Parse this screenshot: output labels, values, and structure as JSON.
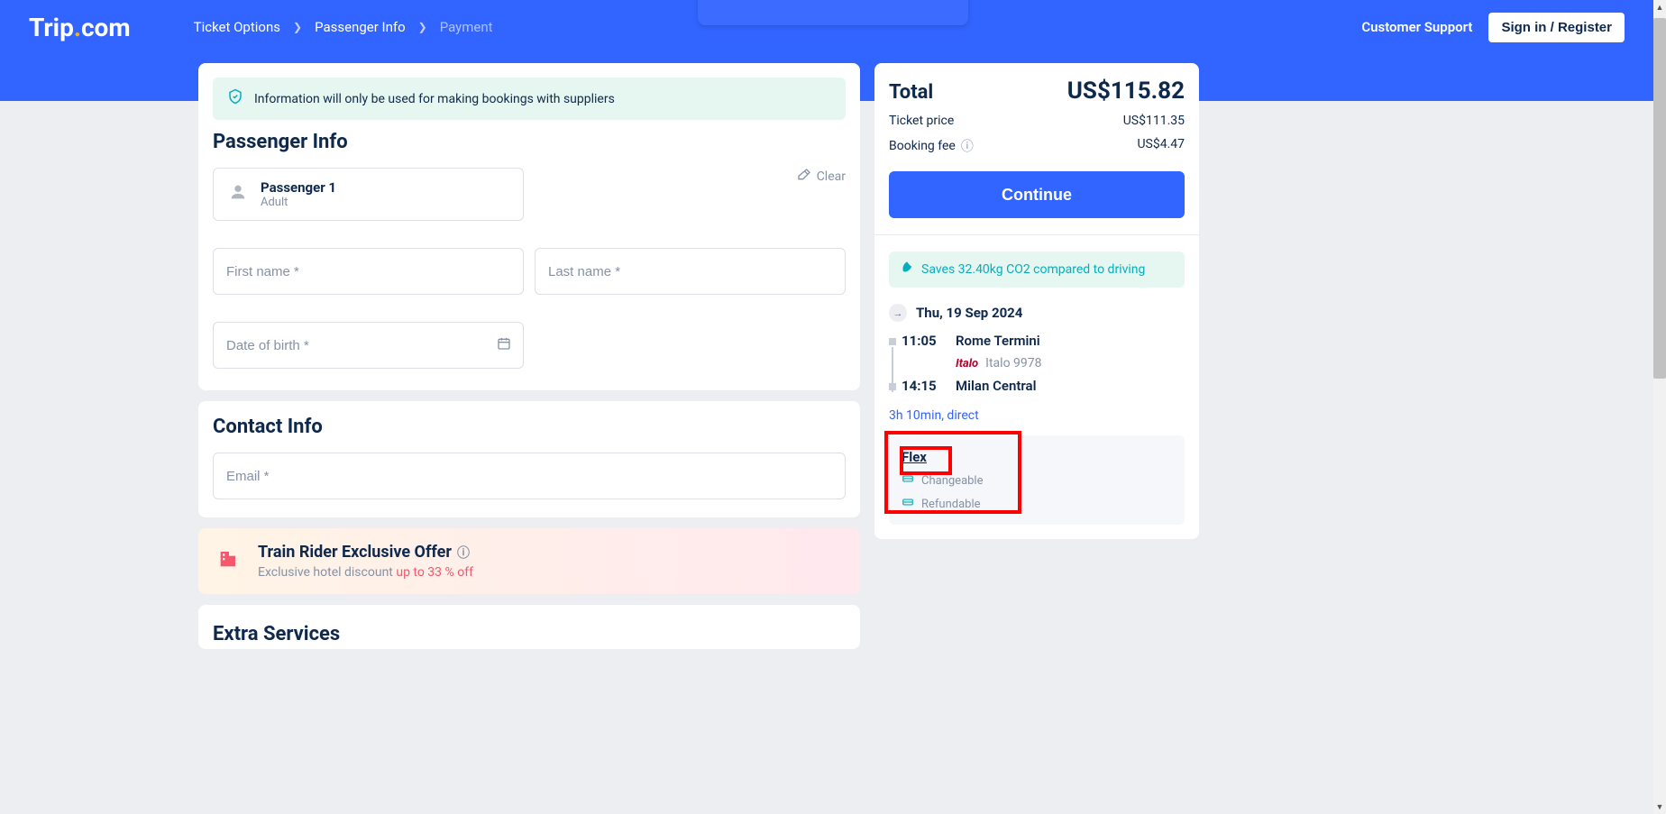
{
  "logo": {
    "text_a": "Trip",
    "dot": ".",
    "text_b": "com"
  },
  "breadcrumb": {
    "step1": "Ticket Options",
    "step2": "Passenger Info",
    "step3": "Payment"
  },
  "header": {
    "support": "Customer Support",
    "signin": "Sign in / Register"
  },
  "info_banner": "Information will only be used for making bookings with suppliers",
  "passenger_section": {
    "title": "Passenger Info",
    "pax_label": "Passenger 1",
    "pax_type": "Adult",
    "clear": "Clear",
    "first_name_ph": "First name *",
    "last_name_ph": "Last name *",
    "dob_ph": "Date of birth *"
  },
  "contact_section": {
    "title": "Contact Info",
    "email_ph": "Email *"
  },
  "promo": {
    "title": "Train Rider Exclusive Offer",
    "sub_a": "Exclusive hotel discount ",
    "sub_b": "up to 33 % off"
  },
  "extra_section": {
    "title": "Extra Services"
  },
  "sidebar": {
    "total_label": "Total",
    "total_value": "US$115.82",
    "ticket_label": "Ticket price",
    "ticket_value": "US$111.35",
    "fee_label": "Booking fee",
    "fee_value": "US$4.47",
    "continue": "Continue",
    "eco": "Saves 32.40kg CO2 compared to driving",
    "date": "Thu, 19 Sep 2024",
    "dep_time": "11:05",
    "dep_station": "Rome Termini",
    "operator_name": "Italo",
    "train_num": "Italo 9978",
    "arr_time": "14:15",
    "arr_station": "Milan Central",
    "duration": "3h 10min, direct",
    "flex_title": "Flex",
    "flex_changeable": "Changeable",
    "flex_refundable": "Refundable"
  }
}
